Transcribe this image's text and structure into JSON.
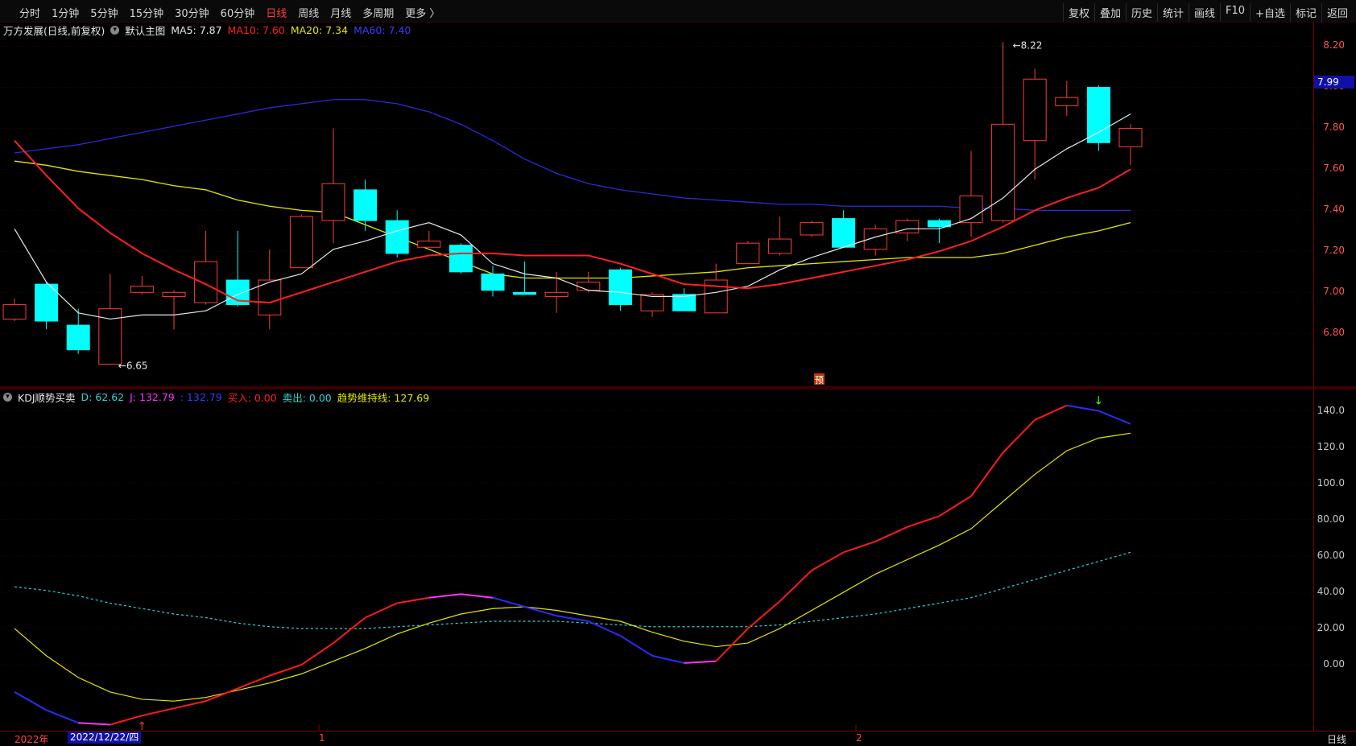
{
  "toolbar": {
    "periods": [
      "分时",
      "1分钟",
      "5分钟",
      "15分钟",
      "30分钟",
      "60分钟",
      "日线",
      "周线",
      "月线",
      "多周期",
      "更多 〉"
    ],
    "active_period": "日线",
    "tools": [
      "复权",
      "叠加",
      "历史",
      "统计",
      "画线",
      "F10",
      "+自选",
      "标记",
      "返回"
    ]
  },
  "main_legend": {
    "stock": "万方发展(日线,前复权)",
    "template": "默认主图",
    "ma5": "MA5: 7.87",
    "ma10": "MA10: 7.60",
    "ma20": "MA20: 7.34",
    "ma60": "MA60: 7.40"
  },
  "kdj_legend": {
    "name": "KDJ顺势买卖",
    "d": "D: 62.62",
    "j": "J: 132.79",
    "k": ": 132.79",
    "buy": "买入: 0.00",
    "sell": "卖出: 0.00",
    "trend": "趋势维持线: 127.69"
  },
  "price_axis": [
    "8.20",
    "8.00",
    "7.80",
    "7.60",
    "7.40",
    "7.20",
    "7.00",
    "6.80"
  ],
  "current_price": "7.99",
  "kdj_axis": [
    "140.0",
    "120.0",
    "100.0",
    "80.00",
    "60.00",
    "40.00",
    "20.00",
    "0.00"
  ],
  "annotations": {
    "high": "8.22",
    "low": "6.65",
    "pre_marker": "预"
  },
  "bottom": {
    "year": "2022年",
    "selected_date": "2022/12/22/四",
    "months": [
      "1",
      "2"
    ],
    "period": "日线"
  },
  "colors": {
    "up": "#ff3b3b",
    "down": "#00ffff",
    "ma5": "#e8e8e8",
    "ma10": "#ff2020",
    "ma20": "#e6e600",
    "ma60": "#2b2bd8",
    "k": "#ff1a1a",
    "d": "#e6e600",
    "trend": "#29d6d6"
  },
  "chart_data": {
    "type": "candlestick",
    "candles": [
      {
        "o": 6.87,
        "c": 6.94,
        "h": 6.97,
        "l": 6.86
      },
      {
        "o": 7.04,
        "c": 6.86,
        "h": 7.05,
        "l": 6.82
      },
      {
        "o": 6.84,
        "c": 6.72,
        "h": 6.92,
        "l": 6.7
      },
      {
        "o": 6.65,
        "c": 6.92,
        "h": 7.09,
        "l": 6.65
      },
      {
        "o": 7.0,
        "c": 7.03,
        "h": 7.08,
        "l": 6.99
      },
      {
        "o": 6.98,
        "c": 7.0,
        "h": 7.01,
        "l": 6.82
      },
      {
        "o": 6.95,
        "c": 7.15,
        "h": 7.3,
        "l": 6.94
      },
      {
        "o": 7.06,
        "c": 6.94,
        "h": 7.3,
        "l": 6.93
      },
      {
        "o": 6.89,
        "c": 7.06,
        "h": 7.21,
        "l": 6.82
      },
      {
        "o": 7.12,
        "c": 7.37,
        "h": 7.38,
        "l": 7.12
      },
      {
        "o": 7.35,
        "c": 7.53,
        "h": 7.8,
        "l": 7.24
      },
      {
        "o": 7.5,
        "c": 7.35,
        "h": 7.55,
        "l": 7.3
      },
      {
        "o": 7.35,
        "c": 7.19,
        "h": 7.4,
        "l": 7.17
      },
      {
        "o": 7.22,
        "c": 7.25,
        "h": 7.3,
        "l": 7.22
      },
      {
        "o": 7.23,
        "c": 7.1,
        "h": 7.24,
        "l": 7.09
      },
      {
        "o": 7.09,
        "c": 7.01,
        "h": 7.13,
        "l": 6.98
      },
      {
        "o": 7.0,
        "c": 6.99,
        "h": 7.15,
        "l": 6.99
      },
      {
        "o": 6.98,
        "c": 7.0,
        "h": 7.1,
        "l": 6.9
      },
      {
        "o": 7.01,
        "c": 7.05,
        "h": 7.1,
        "l": 7.0
      },
      {
        "o": 7.11,
        "c": 6.94,
        "h": 7.12,
        "l": 6.91
      },
      {
        "o": 6.91,
        "c": 6.99,
        "h": 7.0,
        "l": 6.88
      },
      {
        "o": 6.99,
        "c": 6.91,
        "h": 7.02,
        "l": 6.91
      },
      {
        "o": 6.9,
        "c": 7.06,
        "h": 7.14,
        "l": 6.9
      },
      {
        "o": 7.14,
        "c": 7.24,
        "h": 7.25,
        "l": 7.14
      },
      {
        "o": 7.19,
        "c": 7.26,
        "h": 7.37,
        "l": 7.18
      },
      {
        "o": 7.28,
        "c": 7.34,
        "h": 7.35,
        "l": 7.27
      },
      {
        "o": 7.36,
        "c": 7.22,
        "h": 7.4,
        "l": 7.22
      },
      {
        "o": 7.21,
        "c": 7.31,
        "h": 7.33,
        "l": 7.18
      },
      {
        "o": 7.29,
        "c": 7.35,
        "h": 7.36,
        "l": 7.25
      },
      {
        "o": 7.35,
        "c": 7.32,
        "h": 7.36,
        "l": 7.24
      },
      {
        "o": 7.34,
        "c": 7.47,
        "h": 7.69,
        "l": 7.27
      },
      {
        "o": 7.35,
        "c": 7.82,
        "h": 8.22,
        "l": 7.34
      },
      {
        "o": 7.74,
        "c": 8.04,
        "h": 8.09,
        "l": 7.55
      },
      {
        "o": 7.91,
        "c": 7.95,
        "h": 8.03,
        "l": 7.86
      },
      {
        "o": 8.0,
        "c": 7.73,
        "h": 8.01,
        "l": 7.69
      },
      {
        "o": 7.71,
        "c": 7.8,
        "h": 7.82,
        "l": 7.62
      }
    ],
    "ma5": [
      7.31,
      7.05,
      6.9,
      6.87,
      6.89,
      6.89,
      6.91,
      6.99,
      7.05,
      7.09,
      7.21,
      7.25,
      7.3,
      7.34,
      7.28,
      7.14,
      7.09,
      7.07,
      7.01,
      7.0,
      6.98,
      6.98,
      7.0,
      7.03,
      7.11,
      7.17,
      7.22,
      7.27,
      7.31,
      7.31,
      7.36,
      7.46,
      7.6,
      7.7,
      7.78,
      7.87
    ],
    "ma10": [
      7.74,
      7.57,
      7.41,
      7.29,
      7.19,
      7.11,
      7.04,
      6.96,
      6.95,
      7.0,
      7.05,
      7.1,
      7.15,
      7.18,
      7.19,
      7.19,
      7.18,
      7.18,
      7.18,
      7.14,
      7.09,
      7.04,
      7.03,
      7.02,
      7.04,
      7.07,
      7.1,
      7.13,
      7.16,
      7.2,
      7.25,
      7.32,
      7.4,
      7.46,
      7.51,
      7.6
    ],
    "ma20": [
      7.64,
      7.62,
      7.59,
      7.57,
      7.55,
      7.52,
      7.5,
      7.45,
      7.42,
      7.4,
      7.39,
      7.33,
      7.27,
      7.21,
      7.15,
      7.09,
      7.07,
      7.07,
      7.07,
      7.07,
      7.08,
      7.09,
      7.1,
      7.12,
      7.13,
      7.14,
      7.15,
      7.16,
      7.17,
      7.17,
      7.17,
      7.19,
      7.23,
      7.27,
      7.3,
      7.34
    ],
    "ma60": [
      7.68,
      7.7,
      7.72,
      7.75,
      7.78,
      7.81,
      7.84,
      7.87,
      7.9,
      7.92,
      7.94,
      7.94,
      7.92,
      7.88,
      7.82,
      7.74,
      7.65,
      7.58,
      7.53,
      7.5,
      7.48,
      7.46,
      7.45,
      7.44,
      7.43,
      7.43,
      7.42,
      7.42,
      7.42,
      7.42,
      7.41,
      7.41,
      7.4,
      7.4,
      7.4,
      7.4
    ],
    "kdj_k": [
      -15,
      -25,
      -32,
      -33,
      -28,
      -24,
      -20,
      -13,
      -6,
      0,
      12,
      26,
      34,
      37,
      39,
      37,
      32,
      27,
      24,
      16,
      5,
      1,
      2,
      20,
      35,
      52,
      62,
      68,
      76,
      82,
      93,
      117,
      135,
      143,
      140,
      132.79
    ],
    "kdj_d": [
      20,
      5,
      -7,
      -15,
      -19,
      -20,
      -18,
      -14,
      -10,
      -5,
      2,
      9,
      17,
      23,
      28,
      31,
      32,
      30,
      27,
      24,
      18,
      13,
      10,
      12,
      20,
      30,
      40,
      50,
      58,
      66,
      75,
      90,
      105,
      118,
      125,
      127.69
    ],
    "kdj_trend": [
      43,
      41,
      38,
      34,
      31,
      28,
      26,
      23,
      21,
      20,
      20,
      20,
      21,
      22,
      23,
      24,
      24,
      24,
      23,
      22,
      21,
      21,
      21,
      21,
      22,
      24,
      26,
      28,
      31,
      34,
      37,
      42,
      47,
      52,
      57,
      62
    ],
    "price_range": [
      6.55,
      8.3
    ],
    "kdj_range": [
      -35,
      150
    ]
  }
}
